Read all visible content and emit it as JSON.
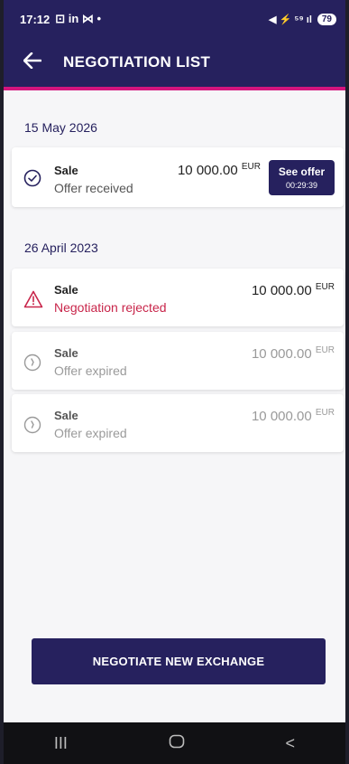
{
  "status_bar": {
    "time": "17:12",
    "notif_icons": "⊡ in ⋈ •",
    "right_icons": "◀ ⚡ ⁵⁹ ıl",
    "battery": "79"
  },
  "header": {
    "title": "NEGOTIATION LIST",
    "back_icon": "arrow-left-icon"
  },
  "groups": [
    {
      "date": "15 May 2026",
      "items": [
        {
          "type": "Sale",
          "status": "Offer received",
          "amount": "10 000.00",
          "currency": "EUR",
          "state": "received",
          "icon": "check-circle-icon",
          "action": {
            "label": "See offer",
            "timer": "00:29:39"
          }
        }
      ]
    },
    {
      "date": "26 April 2023",
      "items": [
        {
          "type": "Sale",
          "status": "Negotiation rejected",
          "amount": "10 000.00",
          "currency": "EUR",
          "state": "rejected",
          "icon": "warning-triangle-icon"
        },
        {
          "type": "Sale",
          "status": "Offer expired",
          "amount": "10 000.00",
          "currency": "EUR",
          "state": "expired",
          "icon": "clock-circle-icon"
        },
        {
          "type": "Sale",
          "status": "Offer expired",
          "amount": "10 000.00",
          "currency": "EUR",
          "state": "expired",
          "icon": "clock-circle-icon"
        }
      ]
    }
  ],
  "cta": {
    "label": "NEGOTIATE NEW EXCHANGE"
  },
  "colors": {
    "primary": "#26215e",
    "accent": "#d4157e",
    "rejected": "#c8254a",
    "muted": "#9a9a9a"
  },
  "nav": {
    "recent": "III",
    "home": "O",
    "back": "<"
  }
}
